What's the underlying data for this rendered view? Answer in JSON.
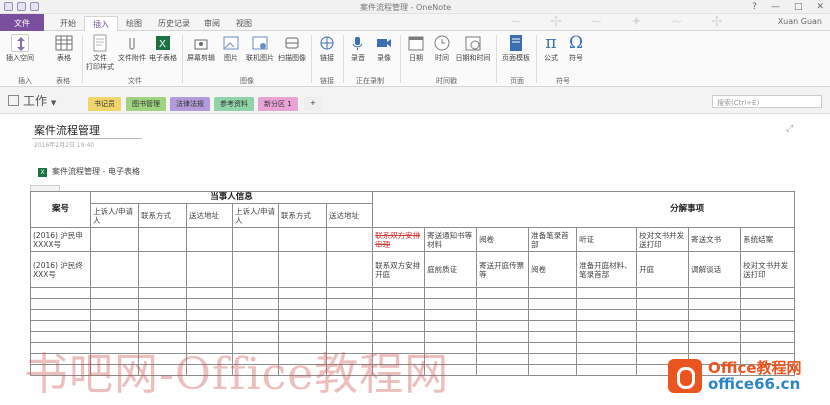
{
  "titlebar": {
    "title": "案件流程管理 - OneNote",
    "winbtns": [
      "?",
      "—",
      "□",
      "✕"
    ]
  },
  "ribbon_tabs": [
    "文件",
    "开始",
    "插入",
    "绘图",
    "历史记录",
    "审阅",
    "视图"
  ],
  "active_tab": "插入",
  "user": "Xuan Guan",
  "ribbon": {
    "buttons": [
      {
        "label": "插入空间",
        "icon": "insert-space-icon",
        "color": "#8b6db4"
      },
      {
        "label": "表格",
        "icon": "table-icon",
        "color": "#6e6e6e"
      },
      {
        "label": "文件\n打印样式",
        "icon": "file-printout-icon",
        "color": "#9a9a9a"
      },
      {
        "label": "文件附件",
        "icon": "attachment-icon",
        "color": "#9a9a9a"
      },
      {
        "label": "电子表格",
        "icon": "spreadsheet-icon",
        "color": "#1e7145"
      },
      {
        "label": "屏幕剪辑",
        "icon": "screen-clipping-icon",
        "color": "#6b6b6b"
      },
      {
        "label": "图片",
        "icon": "picture-icon",
        "color": "#6b8fc1"
      },
      {
        "label": "联机图片",
        "icon": "online-picture-icon",
        "color": "#6b8fc1"
      },
      {
        "label": "扫描图像",
        "icon": "scan-icon",
        "color": "#6b6b6b"
      },
      {
        "label": "链接",
        "icon": "link-icon",
        "color": "#3d6fb3"
      },
      {
        "label": "录音",
        "icon": "audio-icon",
        "color": "#3d6fb3"
      },
      {
        "label": "录像",
        "icon": "video-icon",
        "color": "#3d6fb3"
      },
      {
        "label": "日期",
        "icon": "date-icon",
        "color": "#7b7b7b"
      },
      {
        "label": "时间",
        "icon": "time-icon",
        "color": "#7b7b7b"
      },
      {
        "label": "日期和时间",
        "icon": "datetime-icon",
        "color": "#7b7b7b"
      },
      {
        "label": "页面模板",
        "icon": "page-template-icon",
        "color": "#3d6fb3"
      },
      {
        "label": "公式",
        "icon": "equation-icon",
        "color": "#3d6fb3"
      },
      {
        "label": "符号",
        "icon": "symbol-icon",
        "color": "#3d6fb3"
      }
    ],
    "groups": [
      "插入",
      "表格",
      "文件",
      "图像",
      "链接",
      "正在录制",
      "时间戳",
      "页面",
      "符号"
    ]
  },
  "notebook": {
    "name": "工作"
  },
  "sections": [
    {
      "label": "书记员",
      "color": "#f0d56a"
    },
    {
      "label": "图书管理",
      "color": "#9fd37f"
    },
    {
      "label": "法律法规",
      "color": "#b29bd8"
    },
    {
      "label": "参考资料",
      "color": "#8fd3a8"
    },
    {
      "label": "新分区 1",
      "color": "#e8a3d4"
    },
    {
      "label": "+",
      "color": "#eeeeee"
    }
  ],
  "search": {
    "placeholder": "搜索(Ctrl+E)"
  },
  "page": {
    "title": "案件流程管理",
    "date": "2016年2月2日  19:40",
    "sheet_link": "案件流程管理 - 电子表格"
  },
  "table": {
    "case_no_header": "案号",
    "party_header": "当事人信息",
    "steps_header": "分解事项",
    "sub_headers": [
      "上诉人/申请人",
      "联系方式",
      "送达地址",
      "上诉人/申请人",
      "联系方式",
      "送达地址"
    ],
    "row1": {
      "case": "(2016) 沪民申XXXX号",
      "steps": [
        "联系双方安排审理",
        "寄送通知书等材料",
        "阅卷",
        "准备笔录首部",
        "听证",
        "校对文书并发送打印",
        "寄送文书",
        "系统结案"
      ]
    },
    "row2": {
      "case": "(2016) 沪民终XXX号",
      "steps": [
        "联系双方安排开庭",
        "庭前质证",
        "寄送开庭传票等",
        "阅卷",
        "准备开庭材料、笔录首部",
        "开庭",
        "调解谈话",
        "校对文书并发送打印"
      ]
    }
  },
  "watermark": "书吧网-Office教程网",
  "logo": {
    "line1": "Office教程网",
    "line2": "office66.cn"
  }
}
